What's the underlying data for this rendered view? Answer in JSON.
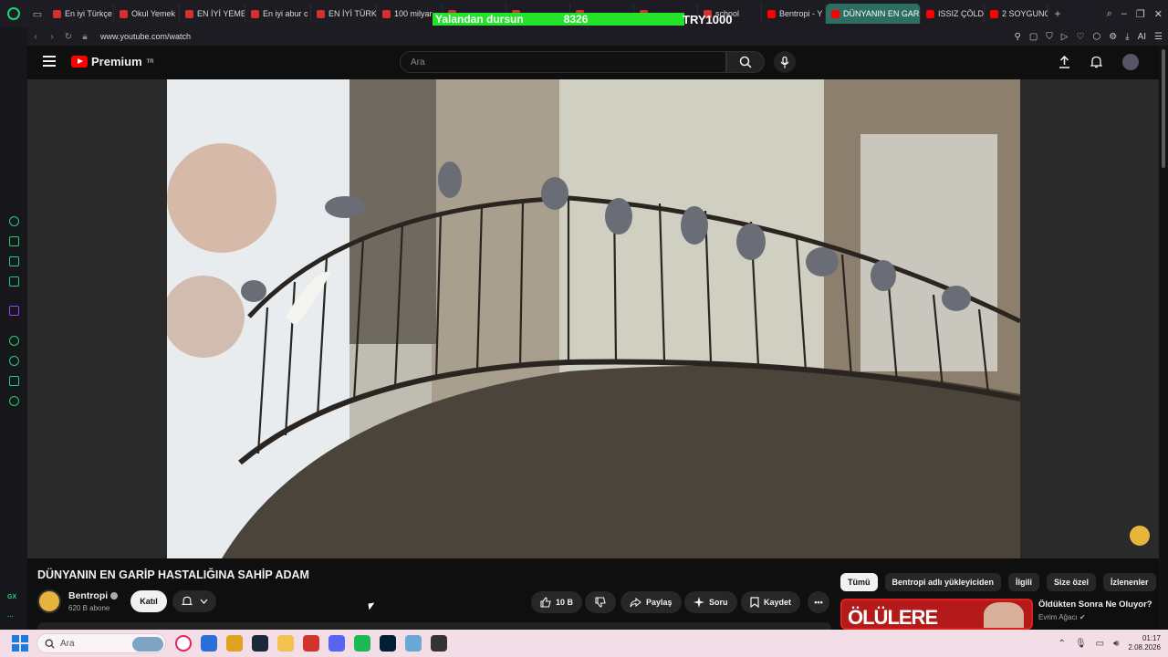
{
  "browser": {
    "tabs": [
      {
        "label": "En iyi Türkçe",
        "icon": "u-icon",
        "color": "#d32f2f"
      },
      {
        "label": "Okul Yemek",
        "icon": "u-icon",
        "color": "#d32f2f"
      },
      {
        "label": "EN İYİ YEMEK",
        "icon": "u-icon",
        "color": "#d32f2f"
      },
      {
        "label": "En iyi abur c",
        "icon": "u-icon",
        "color": "#d32f2f"
      },
      {
        "label": "EN İYİ TÜRK",
        "icon": "u-icon",
        "color": "#d32f2f"
      },
      {
        "label": "100 milyar",
        "icon": "u-icon",
        "color": "#d32f2f"
      },
      {
        "label": "",
        "icon": "u-icon",
        "color": "#d32f2f"
      },
      {
        "label": "",
        "icon": "u-icon",
        "color": "#d32f2f"
      },
      {
        "label": "",
        "icon": "u-icon",
        "color": "#d32f2f"
      },
      {
        "label": "",
        "icon": "u-icon",
        "color": "#d32f2f"
      },
      {
        "label": "school",
        "icon": "u-icon",
        "color": "#d32f2f"
      },
      {
        "label": "Bentropi - Y",
        "icon": "youtube-icon",
        "color": "#ff0000"
      },
      {
        "label": "DÜNYANIN EN GARİ",
        "icon": "youtube-icon",
        "color": "#ff0000",
        "active": true
      },
      {
        "label": "ISSIZ ÇÖLD",
        "icon": "youtube-icon",
        "color": "#ff0000"
      },
      {
        "label": "2 SOYGUNC",
        "icon": "youtube-icon",
        "color": "#ff0000"
      }
    ],
    "new_tab": "+",
    "url": "www.youtube.com/watch",
    "ai_label": "AI"
  },
  "overlay": {
    "ticker_text": "Yalandan dursun",
    "ticker_number": "8326",
    "amount": "TRY1000"
  },
  "sidebar": {
    "gx_label": "GX",
    "more": "···"
  },
  "youtube": {
    "logo": "Premium",
    "logo_region": "TR",
    "search_placeholder": "Ara",
    "video_title": "DÜNYANIN EN GARİP HASTALIĞINA SAHİP ADAM",
    "channel_name": "Bentropi",
    "subscribers": "620 B abone",
    "join_label": "Katıl",
    "likes": "10 B",
    "share_label": "Paylaş",
    "ask_label": "Soru",
    "save_label": "Kaydet",
    "chips": [
      "Tümü",
      "Bentropi adlı yükleyiciden",
      "İlgili",
      "Size özel",
      "İzlenenler"
    ],
    "recommended": {
      "thumb_text": "ÖLÜLERE",
      "title": "Öldükten Sonra Ne Oluyor?",
      "channel": "Evrim Ağacı"
    }
  },
  "taskbar": {
    "search_placeholder": "Ara",
    "time": "01:17",
    "date": "2.08.2026",
    "apps": [
      {
        "name": "opera-gx-icon",
        "color": "#e8205a"
      },
      {
        "name": "store-icon",
        "color": "#2a6fd6"
      },
      {
        "name": "chrome-icon",
        "color": "#e0a020"
      },
      {
        "name": "steam-icon",
        "color": "#1b2838"
      },
      {
        "name": "folder-icon",
        "color": "#f2c14e"
      },
      {
        "name": "acrobat-icon",
        "color": "#d0342c"
      },
      {
        "name": "discord-icon",
        "color": "#5865f2"
      },
      {
        "name": "spotify-icon",
        "color": "#1db954"
      },
      {
        "name": "photoshop-icon",
        "color": "#001e36"
      },
      {
        "name": "network-icon",
        "color": "#6aa8d8"
      },
      {
        "name": "media-icon",
        "color": "#333333"
      }
    ]
  }
}
